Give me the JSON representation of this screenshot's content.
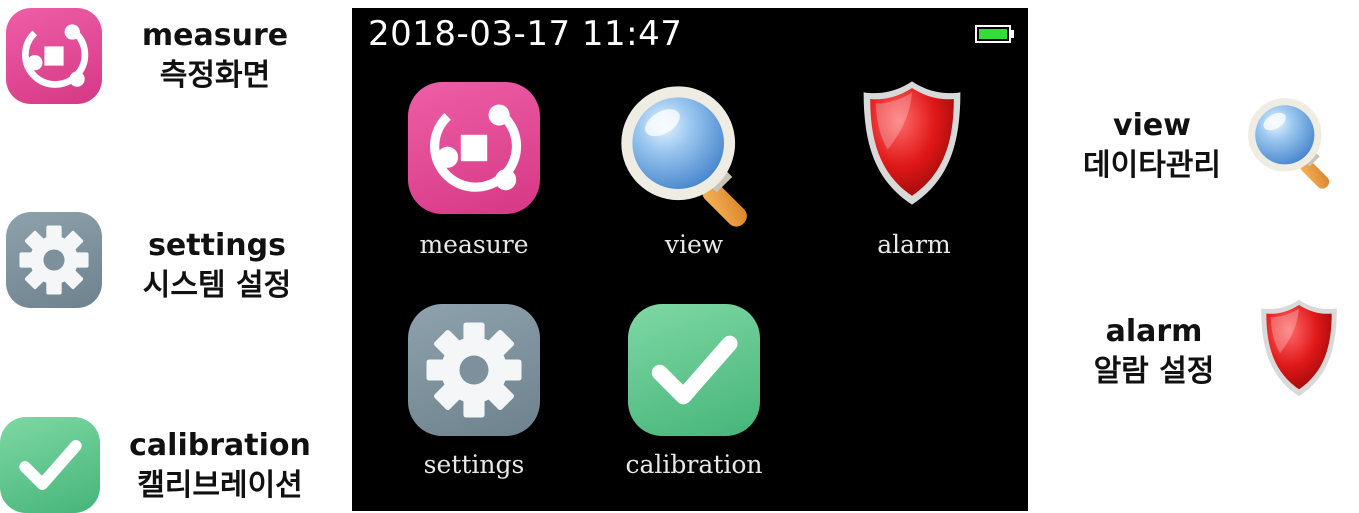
{
  "legend": {
    "measure": {
      "en": "measure",
      "ko": "측정화면",
      "icon": "measure-icon"
    },
    "settings": {
      "en": "settings",
      "ko": "시스템 설정",
      "icon": "gear-icon"
    },
    "calibration": {
      "en": "calibration",
      "ko": "캘리브레이션",
      "icon": "checkmark-icon"
    },
    "view": {
      "en": "view",
      "ko": "데이타관리",
      "icon": "magnifier-icon"
    },
    "alarm": {
      "en": "alarm",
      "ko": "알람 설정",
      "icon": "shield-icon"
    }
  },
  "device": {
    "datetime": "2018-03-17 11:47",
    "battery_level": 1.0,
    "apps": {
      "measure": "measure",
      "view": "view",
      "alarm": "alarm",
      "settings": "settings",
      "calibration": "calibration"
    }
  },
  "colors": {
    "measure": "#e04892",
    "settings": "#7d919c",
    "calibration": "#5cc48a",
    "alarm": "#d01818",
    "battery": "#33dd33",
    "screen": "#000000"
  }
}
